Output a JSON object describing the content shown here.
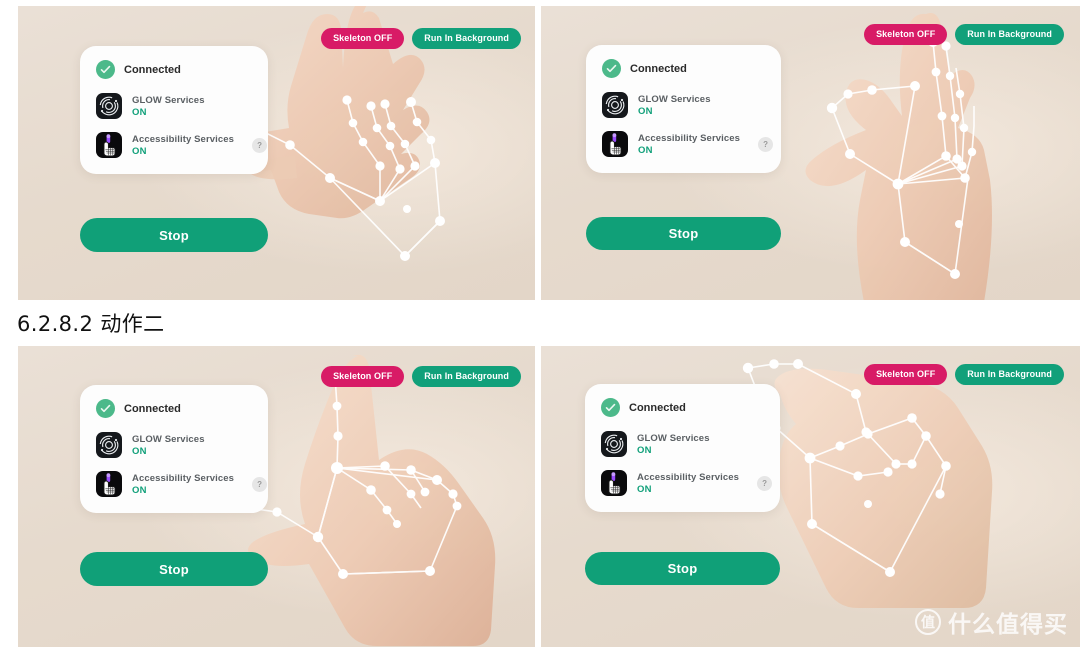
{
  "document": {
    "heading": "6.2.8.2 动作二"
  },
  "watermark": {
    "logo_char": "值",
    "text": "什么值得买"
  },
  "colors": {
    "panel_bg": "#e8ddd2",
    "accent_teal": "#11a07a",
    "accent_pink": "#d81b66",
    "connected_green": "#4cb98a",
    "card_bg": "#fdfdfd",
    "skeleton": "#ffffff"
  },
  "shared_ui": {
    "skeleton_button": "Skeleton OFF",
    "background_button": "Run In Background",
    "connected_label": "Connected",
    "stop_button": "Stop",
    "services": [
      {
        "name": "GLOW Services",
        "state": "ON",
        "icon": "glow-orbit-icon",
        "has_help": false
      },
      {
        "name": "Accessibility Services",
        "state": "ON",
        "icon": "hand-cursor-icon",
        "has_help": true,
        "help_label": "?"
      }
    ]
  },
  "panels": [
    {
      "id": "panel-top-left",
      "position": "top-left",
      "gesture": "open-hand-fingers-curled",
      "skeleton_button": "Skeleton OFF",
      "background_button": "Run In Background",
      "connected_label": "Connected",
      "stop_button": "Stop",
      "services": [
        {
          "name": "GLOW Services",
          "state": "ON"
        },
        {
          "name": "Accessibility Services",
          "state": "ON",
          "help_label": "?"
        }
      ]
    },
    {
      "id": "panel-top-right",
      "position": "top-right",
      "gesture": "thumb-index-pinch",
      "skeleton_button": "Skeleton OFF",
      "background_button": "Run In Background",
      "connected_label": "Connected",
      "stop_button": "Stop",
      "services": [
        {
          "name": "GLOW Services",
          "state": "ON"
        },
        {
          "name": "Accessibility Services",
          "state": "ON",
          "help_label": "?"
        }
      ]
    },
    {
      "id": "panel-bottom-left",
      "position": "bottom-left",
      "gesture": "index-finger-pointing-up",
      "skeleton_button": "Skeleton OFF",
      "background_button": "Run In Background",
      "connected_label": "Connected",
      "stop_button": "Stop",
      "services": [
        {
          "name": "GLOW Services",
          "state": "ON"
        },
        {
          "name": "Accessibility Services",
          "state": "ON",
          "help_label": "?"
        }
      ]
    },
    {
      "id": "panel-bottom-right",
      "position": "bottom-right",
      "gesture": "fingers-folded-closed",
      "skeleton_button": "Skeleton OFF",
      "background_button": "Run In Background",
      "connected_label": "Connected",
      "stop_button": "Stop",
      "services": [
        {
          "name": "GLOW Services",
          "state": "ON"
        },
        {
          "name": "Accessibility Services",
          "state": "ON",
          "help_label": "?"
        }
      ]
    }
  ]
}
